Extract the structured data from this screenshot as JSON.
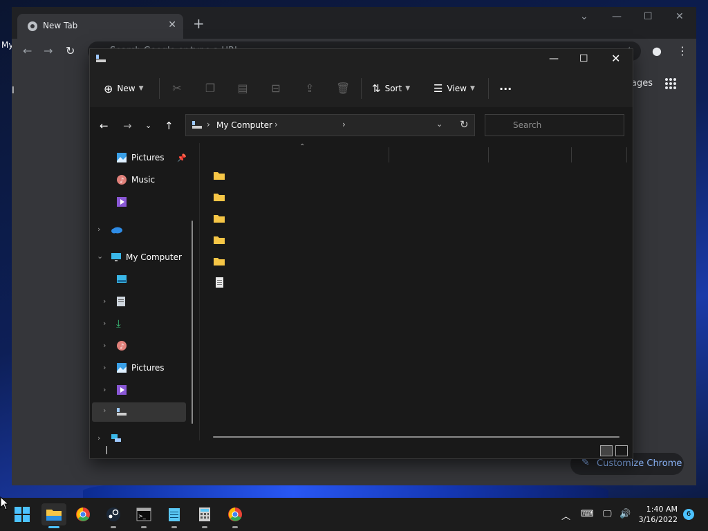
{
  "desktop": {
    "label": "My"
  },
  "chrome": {
    "tab_title": "New Tab",
    "omnibox_placeholder": "Search Google or type a URL",
    "images_link": "ages",
    "customize_label": "Customize Chrome",
    "left_text": "I"
  },
  "explorer": {
    "cmdbar": {
      "new_label": "New",
      "sort_label": "Sort",
      "view_label": "View",
      "more_label": "···"
    },
    "address": {
      "path": "My Computer"
    },
    "search": {
      "placeholder": "Search"
    },
    "nav": {
      "pictures_pinned": "Pictures",
      "music": "Music",
      "my_computer": "My Computer",
      "pictures": "Pictures"
    }
  },
  "taskbar": {
    "time": "1:40 AM",
    "date": "3/16/2022",
    "notification_count": "6"
  },
  "colors": {
    "accent": "#4cc2ff",
    "folder": "#f6c646"
  }
}
